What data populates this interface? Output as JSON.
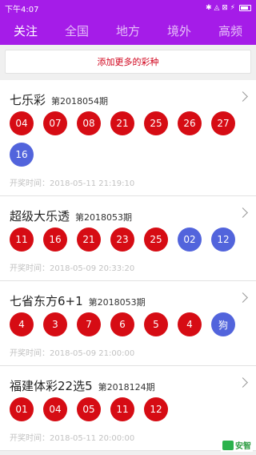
{
  "status": {
    "time": "下午4:07",
    "icons": "✱ ◬ ⊠ ⚡"
  },
  "tabs": [
    {
      "label": "关注",
      "active": true
    },
    {
      "label": "全国",
      "active": false
    },
    {
      "label": "地方",
      "active": false
    },
    {
      "label": "境外",
      "active": false
    },
    {
      "label": "高频",
      "active": false
    }
  ],
  "add_button": "添加更多的彩种",
  "lotteries": [
    {
      "name": "七乐彩",
      "issue": "第2018054期",
      "balls": [
        {
          "value": "04",
          "color": "red"
        },
        {
          "value": "07",
          "color": "red"
        },
        {
          "value": "08",
          "color": "red"
        },
        {
          "value": "21",
          "color": "red"
        },
        {
          "value": "25",
          "color": "red"
        },
        {
          "value": "26",
          "color": "red"
        },
        {
          "value": "27",
          "color": "red"
        },
        {
          "value": "16",
          "color": "blue"
        }
      ],
      "time": "开奖时间：2018-05-11 21:19:10"
    },
    {
      "name": "超级大乐透",
      "issue": "第2018053期",
      "balls": [
        {
          "value": "11",
          "color": "red"
        },
        {
          "value": "16",
          "color": "red"
        },
        {
          "value": "21",
          "color": "red"
        },
        {
          "value": "23",
          "color": "red"
        },
        {
          "value": "25",
          "color": "red"
        },
        {
          "value": "02",
          "color": "blue"
        },
        {
          "value": "12",
          "color": "blue"
        }
      ],
      "time": "开奖时间：2018-05-09 20:33:20"
    },
    {
      "name": "七省东方6+1",
      "issue": "第2018053期",
      "balls": [
        {
          "value": "4",
          "color": "red"
        },
        {
          "value": "3",
          "color": "red"
        },
        {
          "value": "7",
          "color": "red"
        },
        {
          "value": "6",
          "color": "red"
        },
        {
          "value": "5",
          "color": "red"
        },
        {
          "value": "4",
          "color": "red"
        },
        {
          "value": "狗",
          "color": "blue"
        }
      ],
      "time": "开奖时间：2018-05-09 21:00:00"
    },
    {
      "name": "福建体彩22选5",
      "issue": "第2018124期",
      "balls": [
        {
          "value": "01",
          "color": "red"
        },
        {
          "value": "04",
          "color": "red"
        },
        {
          "value": "05",
          "color": "red"
        },
        {
          "value": "11",
          "color": "red"
        },
        {
          "value": "12",
          "color": "red"
        }
      ],
      "time": "开奖时间：2018-05-11 20:00:00"
    }
  ],
  "watermark": "安智",
  "colors": {
    "accent": "#a51ce8",
    "red_ball": "#d60c14",
    "blue_ball": "#5264dc"
  }
}
